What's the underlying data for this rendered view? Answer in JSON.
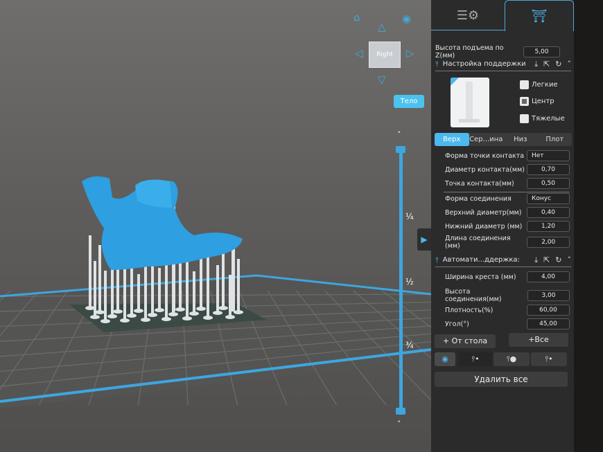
{
  "viewport": {
    "view_cube_label": "Right",
    "body_button": "Тело",
    "slider_labels": [
      "¼",
      "½",
      "¾"
    ],
    "expand_icon": "triangle-right"
  },
  "panel": {
    "tabs": [
      {
        "icon": "settings-list-icon"
      },
      {
        "icon": "support-structure-icon",
        "active": true
      }
    ],
    "lift_height": {
      "label": "Высота подъема по Z(мм)",
      "value": "5,00"
    },
    "support_settings": {
      "title": "Настройка поддержки",
      "presets": [
        {
          "label": "Легкие",
          "checked": false
        },
        {
          "label": "Центр",
          "checked": true
        },
        {
          "label": "Тяжелые",
          "checked": false
        }
      ],
      "subtabs": [
        "Верх",
        "Сер...ина",
        "Низ",
        "Плот"
      ],
      "active_subtab": "Верх",
      "fields": [
        {
          "label": "Форма точки контакта",
          "value": "Нет",
          "type": "select"
        },
        {
          "label": "Диаметр контакта(мм)",
          "value": "0,70"
        },
        {
          "label": "Точка контакта(мм)",
          "value": "0,50"
        },
        {
          "label": "Форма соединения",
          "value": "Конус",
          "type": "select"
        },
        {
          "label": "Верхний диаметр(мм)",
          "value": "0,40"
        },
        {
          "label": "Нижний диаметр (мм)",
          "value": "1,20"
        },
        {
          "label": "Длина соединения (мм)",
          "value": "2,00"
        }
      ]
    },
    "auto_support": {
      "title": "Автомати...ддержка:",
      "fields": [
        {
          "label": "Ширина креста (мм)",
          "value": "4,00"
        },
        {
          "label": "Высота соединения(мм)",
          "value": "3,00"
        },
        {
          "label": "Плотность(%)",
          "value": "60,00"
        },
        {
          "label": "Угол(°)",
          "value": "45,00"
        }
      ],
      "from_table": "+ От стола",
      "all": "+Все"
    },
    "delete_all": "Удалить все"
  },
  "colors": {
    "accent": "#4cb8ee",
    "model": "#2e9fe0",
    "panel": "#2b2b2b"
  }
}
